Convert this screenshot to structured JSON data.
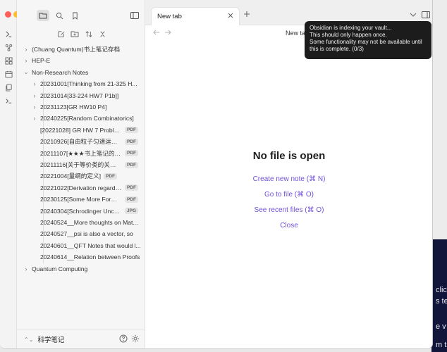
{
  "sidebar": {
    "tree": [
      {
        "label": "(Chuang Quantum)书上笔记存档",
        "expander": "›",
        "indent": 0
      },
      {
        "label": "HEP-E",
        "expander": "›",
        "indent": 0
      },
      {
        "label": "Non-Research Notes",
        "expander": "⌄",
        "indent": 0
      },
      {
        "label": "20231001[Thinking from 21-325 H...",
        "expander": "›",
        "indent": 1
      },
      {
        "label": "20231014[33-224 HW7 P1b]]",
        "expander": "›",
        "indent": 1
      },
      {
        "label": "20231123[GR HW10 P4]",
        "expander": "›",
        "indent": 1
      },
      {
        "label": "20240225[Random Combinatorics]",
        "expander": "›",
        "indent": 1
      },
      {
        "label": "[20221028] GR HW 7 Proble...",
        "badge": "PDF",
        "indent": 1
      },
      {
        "label": "20210926[自由粒子匀速运动...",
        "badge": "PDF",
        "indent": 1
      },
      {
        "label": "20211107[★★★书上笔记的一...",
        "badge": "PDF",
        "indent": 1
      },
      {
        "label": "20211116[关于等价类的关系以...",
        "badge": "PDF",
        "indent": 1
      },
      {
        "label": "20221004[量纲的定义]",
        "badge": "PDF",
        "indent": 1
      },
      {
        "label": "20221022[Derivation regardin...",
        "badge": "PDF",
        "indent": 1
      },
      {
        "label": "20230125[Some More Formal...",
        "badge": "PDF",
        "indent": 1
      },
      {
        "label": "20240304[Schrodinger Unce...",
        "badge": "JPG",
        "indent": 1
      },
      {
        "label": "20240524__More thoughts on Mat...",
        "indent": 1
      },
      {
        "label": "20240527__psi is also a vector, so",
        "indent": 1
      },
      {
        "label": "20240601__QFT Notes that would l...",
        "indent": 1
      },
      {
        "label": "20240614__Relation between Proofs",
        "indent": 1
      },
      {
        "label": "Quantum Computing",
        "expander": "›",
        "indent": 0
      }
    ],
    "vault_name": "科学笔记",
    "vault_switcher": "⌃⌄"
  },
  "tabs": {
    "active_label": "New tab",
    "view_title": "New ta"
  },
  "empty_state": {
    "title": "No file is open",
    "actions": [
      "Create new note (⌘ N)",
      "Go to file (⌘ O)",
      "See recent files (⌘ O)",
      "Close"
    ]
  },
  "toast": {
    "lines": [
      "Obsidian is indexing your vault...",
      "This should only happen once.",
      "Some functionality may not be available until",
      "this is complete. (0/3)"
    ]
  },
  "background_fragments": [
    "click",
    "s te",
    "e v",
    "m t"
  ],
  "colors": {
    "accent": "#6f4fd8",
    "traffic_close": "#fe5f57",
    "traffic_minimize": "#febc2e",
    "traffic_zoom": "#28c840",
    "toast_bg": "#1c1c1c"
  }
}
